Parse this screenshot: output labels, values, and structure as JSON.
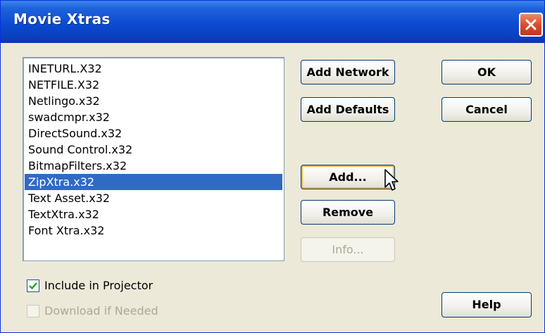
{
  "window": {
    "title": "Movie Xtras"
  },
  "xtras_list": {
    "items": [
      "INETURL.X32",
      "NETFILE.X32",
      "Netlingo.x32",
      "swadcmpr.x32",
      "DirectSound.x32",
      "Sound Control.x32",
      "BitmapFilters.x32",
      "ZipXtra.x32",
      "Text Asset.x32",
      "TextXtra.x32",
      "Font Xtra.x32"
    ],
    "selected_index": 7
  },
  "buttons": {
    "add_network": "Add Network",
    "add_defaults": "Add Defaults",
    "add": "Add...",
    "remove": "Remove",
    "info": "Info...",
    "ok": "OK",
    "cancel": "Cancel",
    "help": "Help"
  },
  "options": {
    "include_in_projector": {
      "label": "Include in Projector",
      "checked": true
    },
    "download_if_needed": {
      "label": "Download if Needed",
      "checked": false,
      "disabled": true
    }
  },
  "colors": {
    "title_bar": "#0c4bd2",
    "selection": "#316ac5",
    "dialog_bg": "#ece9d8",
    "close_button": "#d9482a"
  }
}
